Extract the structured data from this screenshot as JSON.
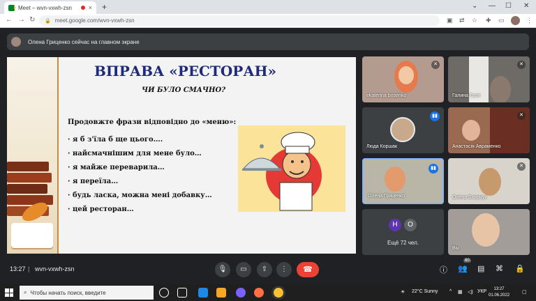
{
  "browser": {
    "tab_title": "Meet – wvn-vxwh-zsn",
    "tab_close": "×",
    "new_tab": "+",
    "url": "meet.google.com/wvn-vxwh-zsn"
  },
  "banner": {
    "text": "Олена Гриценко сейчас на главном экране"
  },
  "slide": {
    "title": "ВПРАВА «РЕСТОРАН»",
    "subtitle": "ЧИ БУЛО СМАЧНО?",
    "lead": "Продовжте фрази відповідно до «меню»:",
    "bullets": [
      "· я б з'їла б ще цього….",
      "· найсмачнішим для мене було…",
      "· я майже переварила…",
      "· я переїла…",
      "· будь ласка, можна мені добавку…",
      "· цей ресторан…"
    ]
  },
  "participants": [
    {
      "name": "ekaterina bosenko",
      "state": "muted"
    },
    {
      "name": "Галина Галя",
      "state": "muted"
    },
    {
      "name": "Люда Коршак",
      "state": "talking"
    },
    {
      "name": "Анастасія Авраменко",
      "state": "muted"
    },
    {
      "name": "Олена Гриценко",
      "state": "talking"
    },
    {
      "name": "Олена Боярчук",
      "state": "muted"
    },
    {
      "name": "Вы",
      "state": "none"
    }
  ],
  "more": {
    "initials": [
      "Н",
      "О"
    ],
    "label": "Ещё 72 чел.",
    "colors": [
      "#5e35b1",
      "#5f6368"
    ]
  },
  "bottom": {
    "time": "13:27",
    "separator": "|",
    "code": "wvn-vxwh-zsn",
    "people_count": "80"
  },
  "taskbar": {
    "search_placeholder": "Чтобы начать поиск, введите",
    "weather": "22°C Sunny",
    "lang": "УКР",
    "time": "13:27",
    "date": "01.06.2022"
  },
  "colors": {
    "end_call": "#ea4335",
    "talking": "#1a73e8",
    "slide_title": "#1f2b78"
  }
}
